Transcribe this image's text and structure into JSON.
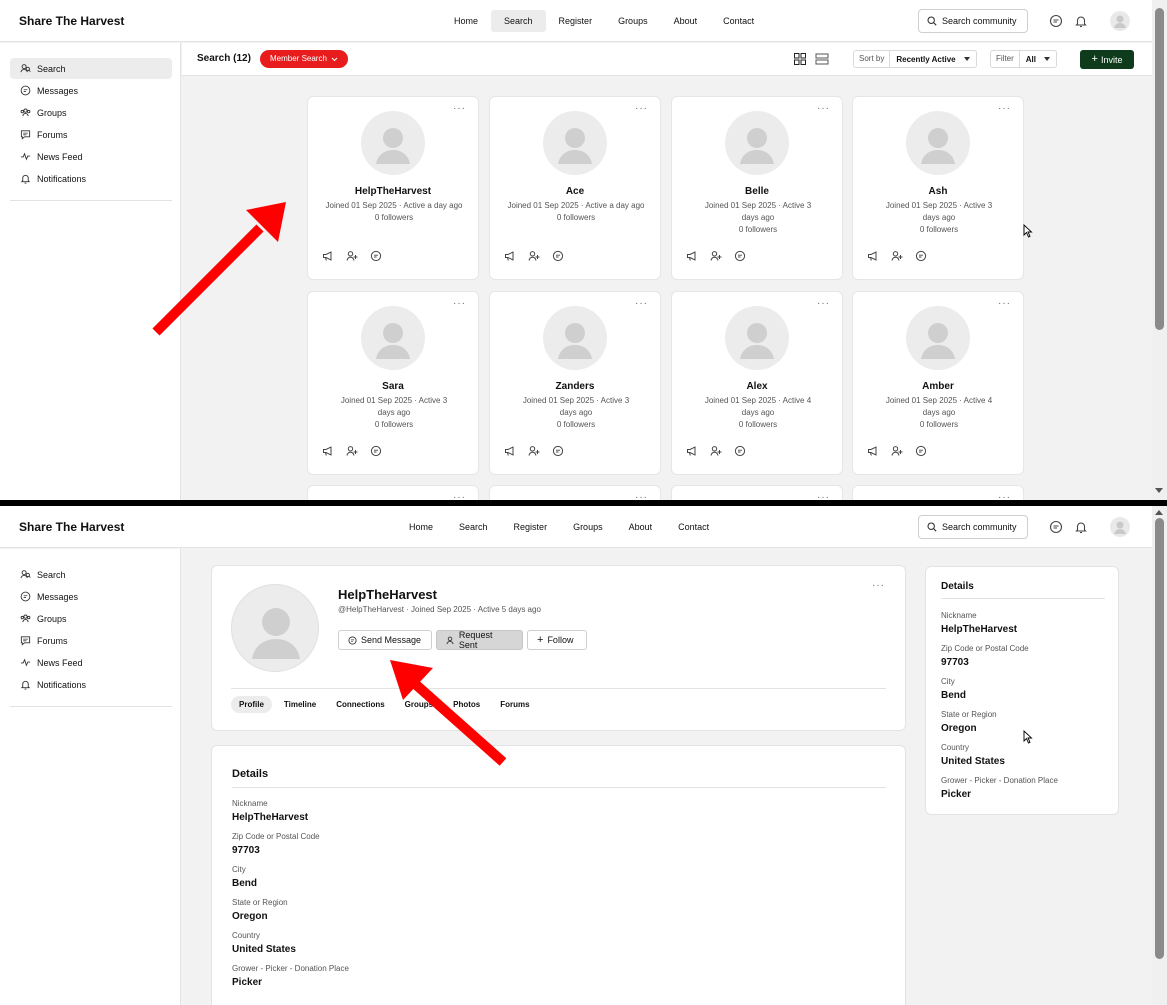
{
  "app": {
    "title": "Share The Harvest"
  },
  "nav": {
    "items": [
      "Home",
      "Search",
      "Register",
      "Groups",
      "About",
      "Contact"
    ]
  },
  "search": {
    "label": "Search community"
  },
  "sidebar": {
    "items": [
      "Search",
      "Messages",
      "Groups",
      "Forums",
      "News Feed",
      "Notifications"
    ]
  },
  "screen1": {
    "title": "Search (12)",
    "filter_pill": "Member Search",
    "sort_label": "Sort by",
    "sort_value": "Recently Active",
    "filter_label": "Filter",
    "filter_value": "All",
    "invite_label": "Invite",
    "members": [
      {
        "name": "HelpTheHarvest",
        "meta1": "Joined 01 Sep 2025 · Active a day ago",
        "meta2": "",
        "followers": "0 followers"
      },
      {
        "name": "Ace",
        "meta1": "Joined 01 Sep 2025 · Active a day ago",
        "meta2": "",
        "followers": "0 followers"
      },
      {
        "name": "Belle",
        "meta1": "Joined 01 Sep 2025 · Active 3",
        "meta2": "days ago",
        "followers": "0 followers"
      },
      {
        "name": "Ash",
        "meta1": "Joined 01 Sep 2025 · Active 3",
        "meta2": "days ago",
        "followers": "0 followers"
      },
      {
        "name": "Sara",
        "meta1": "Joined 01 Sep 2025 · Active 3",
        "meta2": "days ago",
        "followers": "0 followers"
      },
      {
        "name": "Zanders",
        "meta1": "Joined 01 Sep 2025 · Active 3",
        "meta2": "days ago",
        "followers": "0 followers"
      },
      {
        "name": "Alex",
        "meta1": "Joined 01 Sep 2025 · Active 4",
        "meta2": "days ago",
        "followers": "0 followers"
      },
      {
        "name": "Amber",
        "meta1": "Joined 01 Sep 2025 · Active 4",
        "meta2": "days ago",
        "followers": "0 followers"
      }
    ]
  },
  "screen2": {
    "profile": {
      "name": "HelpTheHarvest",
      "meta": "@HelpTheHarvest · Joined Sep 2025 · Active 5 days ago",
      "send_message": "Send Message",
      "request_sent": "Request Sent",
      "follow": "Follow"
    },
    "tabs": [
      "Profile",
      "Timeline",
      "Connections",
      "Groups",
      "Photos",
      "Forums"
    ],
    "details_title": "Details",
    "fields": [
      {
        "label": "Nickname",
        "value": "HelpTheHarvest"
      },
      {
        "label": "Zip Code or Postal Code",
        "value": "97703"
      },
      {
        "label": "City",
        "value": "Bend"
      },
      {
        "label": "State or Region",
        "value": "Oregon"
      },
      {
        "label": "Country",
        "value": "United States"
      },
      {
        "label": "Grower - Picker - Donation Place",
        "value": "Picker"
      }
    ]
  },
  "colors": {
    "accent_red": "#e81c1c",
    "invite_green": "#0d3b1c",
    "arrow_red": "#ff0000"
  }
}
